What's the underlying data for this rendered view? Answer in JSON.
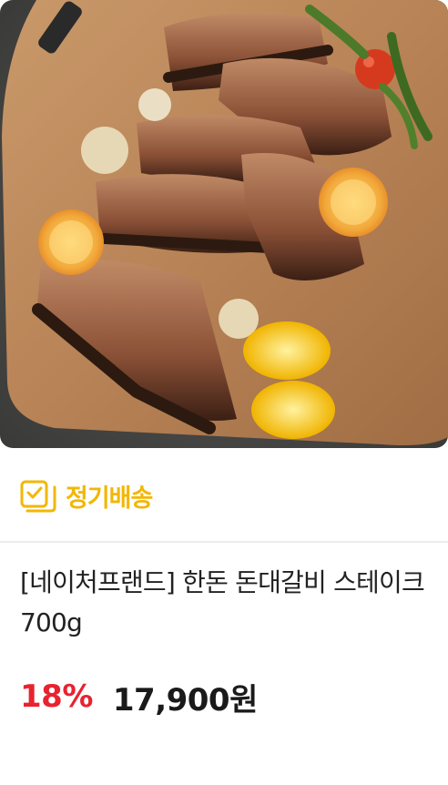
{
  "product": {
    "image_icon": "bbq-pork-ribs-photo",
    "badge": {
      "icon": "calendar-check-icon",
      "label": "정기배송",
      "color": "#f2b705"
    },
    "title": "[네이처프랜드] 한돈 돈대갈비 스테이크 700g",
    "discount": "18%",
    "discount_color": "#e8232f",
    "price": "17,900원"
  }
}
